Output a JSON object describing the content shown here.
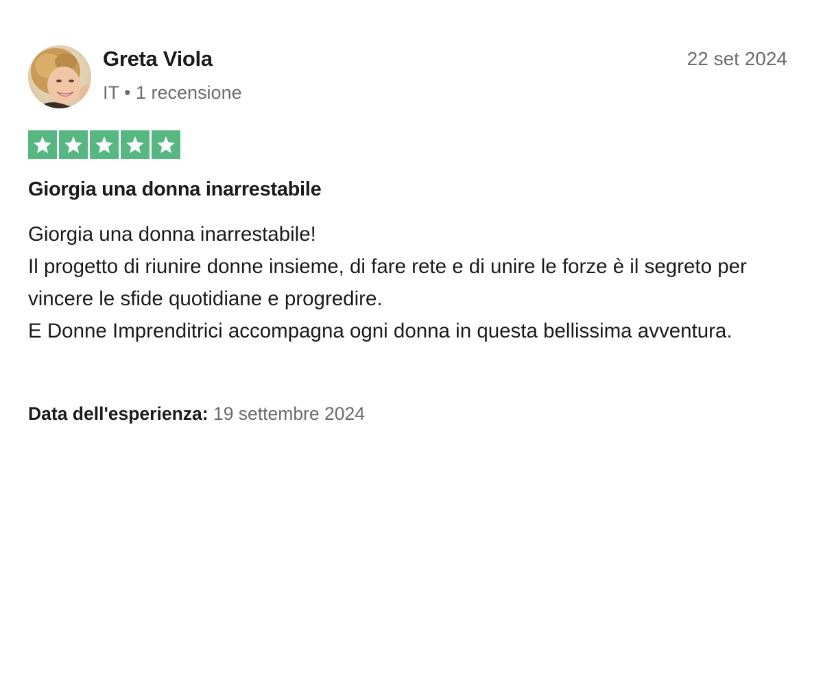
{
  "reviewer": {
    "name": "Greta Viola",
    "country": "IT",
    "separator": "•",
    "review_count": "1 recensione"
  },
  "review": {
    "date": "22 set 2024",
    "rating": 5,
    "rating_max": 5,
    "star_color": "#56b880",
    "title": "Giorgia una donna inarrestabile",
    "body_lines": [
      "Giorgia una donna inarrestabile!",
      "Il progetto di riunire donne insieme, di fare rete e di unire le forze è il segreto per vincere le sfide quotidiane e progredire.",
      "E Donne Imprenditrici accompagna ogni donna in questa bellissima avventura."
    ],
    "experience_label": "Data dell'esperienza:",
    "experience_date": "19 settembre 2024"
  },
  "icons": {
    "star": "star-icon",
    "avatar": "profile-photo"
  }
}
